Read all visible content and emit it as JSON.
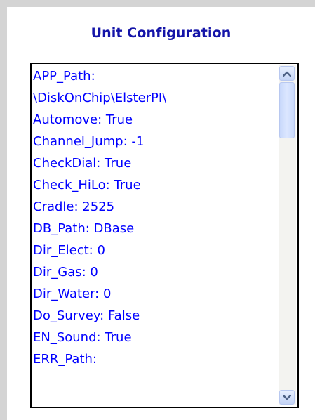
{
  "title": "Unit Configuration",
  "items": [
    "APP_Path:",
    "\\DiskOnChip\\ElsterPI\\",
    "Automove: True",
    "Channel_Jump: -1",
    "CheckDial: True",
    "Check_HiLo: True",
    "Cradle: 2525",
    "DB_Path: DBase",
    "Dir_Elect: 0",
    "Dir_Gas: 0",
    "Dir_Water: 0",
    "Do_Survey: False",
    "EN_Sound: True",
    "ERR_Path:"
  ],
  "colors": {
    "title": "#1414a8",
    "item_text": "#0000ff",
    "border": "#000000",
    "frame": "#d4d4d4",
    "scroll_track": "#f3f3f0",
    "scroll_thumb": "#c8d8fb",
    "arrow": "#4d6185"
  },
  "icons": {
    "scroll_up": "chevron-up-icon",
    "scroll_down": "chevron-down-icon"
  }
}
